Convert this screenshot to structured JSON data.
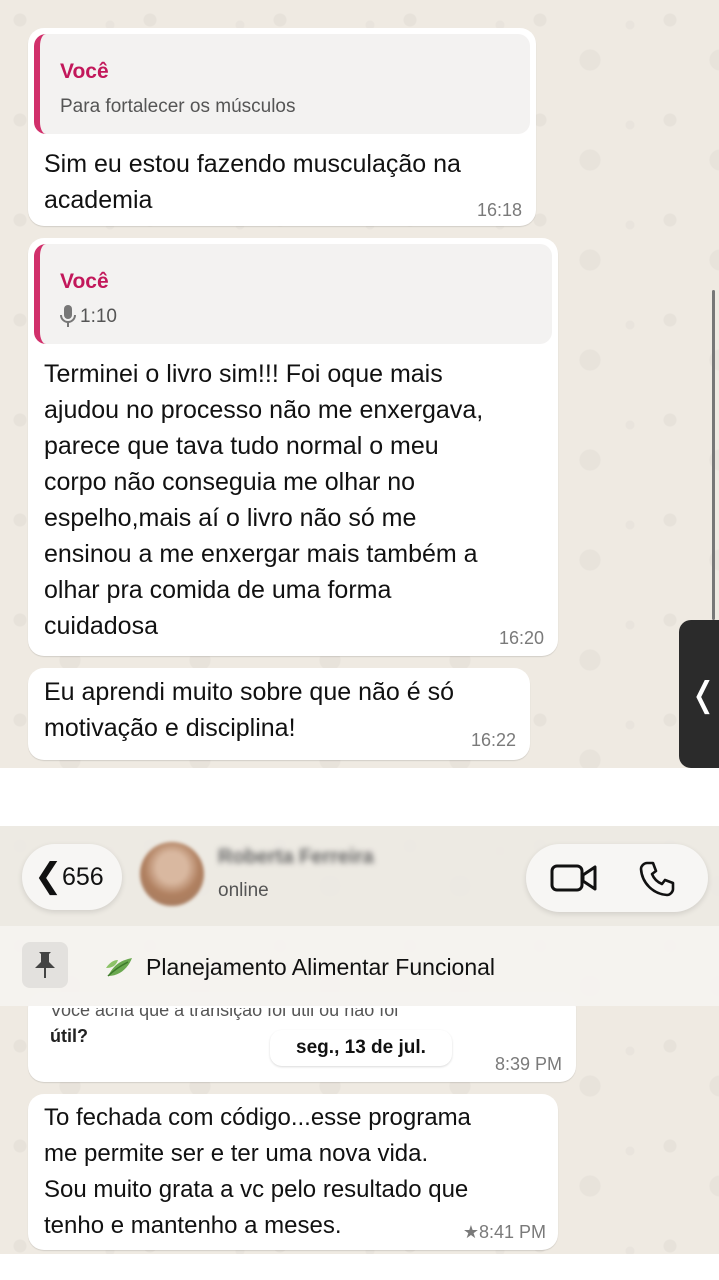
{
  "top_chat": {
    "messages": [
      {
        "quote": {
          "author": "Você",
          "text": "Para fortalecer os músculos"
        },
        "text": "Sim eu estou fazendo musculação na\nacademia",
        "time": "16:18"
      },
      {
        "quote": {
          "author": "Você",
          "text": "1:10",
          "icon": "microphone-icon"
        },
        "text": "Terminei o livro sim!!! Foi oque mais\najudou no processo não me enxergava,\nparece que tava tudo normal o meu\ncorpo não conseguia me olhar no\nespelho,mais aí o livro não só me\nensinou a me enxergar mais também a\nolhar pra comida de uma forma\ncuidadosa",
        "time": "16:20"
      },
      {
        "text": "Eu aprendi muito sobre que não é só\nmotivação e disciplina!",
        "time": "16:22"
      }
    ],
    "side_handle_icon": "chevron-left-icon",
    "side_handle_glyph": "❬"
  },
  "header": {
    "back_glyph": "❮",
    "unread_count": "656",
    "contact_name": "Roberta Ferreira",
    "status": "online",
    "icons": [
      "chevron-left-icon",
      "avatar",
      "video-call-icon",
      "phone-call-icon"
    ]
  },
  "pinned": {
    "icon": "pin-icon",
    "leaf_icon": "leaf-icon",
    "text": "Planejamento Alimentar Funcional"
  },
  "bottom_chat": {
    "partial_message": {
      "cut_text": "Você acha que a transição foi útil ou não foi",
      "text": "útil?",
      "time": "8:39 PM"
    },
    "date_badge": "seg., 13 de jul.",
    "message": {
      "text": "To fechada com código...esse programa\nme permite ser e ter uma nova vida.\nSou muito grata a vc pelo resultado que\ntenho e mantenho a meses.",
      "time": "★8:41 PM"
    }
  },
  "colors": {
    "chat_background": "#efeae2",
    "bubble": "#ffffff",
    "quote_bar": "#d1306b",
    "quote_author": "#c2185b"
  }
}
